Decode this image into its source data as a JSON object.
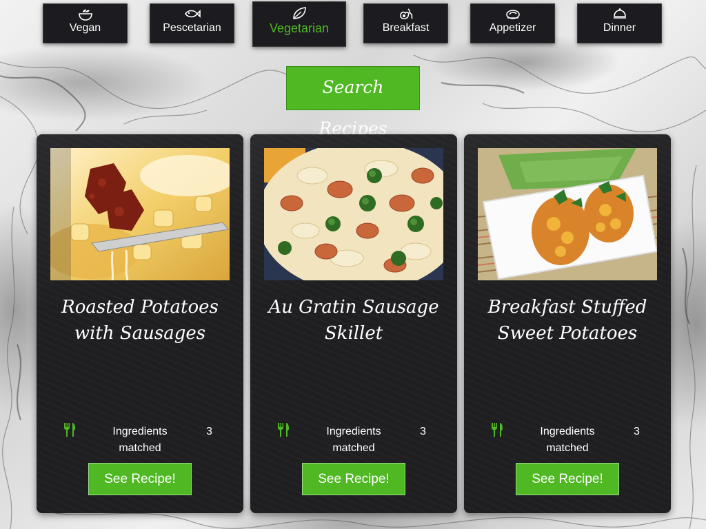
{
  "categories": [
    {
      "label": "Vegan",
      "icon": "bowl-icon",
      "active": false
    },
    {
      "label": "Pescetarian",
      "icon": "fish-icon",
      "active": false
    },
    {
      "label": "Vegetarian",
      "icon": "leaf-icon",
      "active": true
    },
    {
      "label": "Breakfast",
      "icon": "eggs-bacon-icon",
      "active": false
    },
    {
      "label": "Appetizer",
      "icon": "plate-icon",
      "active": false
    },
    {
      "label": "Dinner",
      "icon": "cloche-icon",
      "active": false
    }
  ],
  "search": {
    "label": "Search Recipes"
  },
  "recipes": [
    {
      "title_line1": "Roasted Potatoes",
      "title_line2": "with Sausages",
      "ingredients_label_line1": "Ingredients",
      "ingredients_label_line2": "matched",
      "ingredients_count": "3",
      "button_label": "See Recipe!"
    },
    {
      "title_line1": "Au Gratin Sausage",
      "title_line2": "Skillet",
      "ingredients_label_line1": "Ingredients",
      "ingredients_label_line2": "matched",
      "ingredients_count": "3",
      "button_label": "See Recipe!"
    },
    {
      "title_line1": "Breakfast Stuffed",
      "title_line2": "Sweet Potatoes",
      "ingredients_label_line1": "Ingredients",
      "ingredients_label_line2": "matched",
      "ingredients_count": "3",
      "button_label": "See Recipe!"
    }
  ],
  "colors": {
    "accent_green": "#4fb823",
    "card_background": "#1f1f22",
    "tab_background": "#1c1c20",
    "text_white": "#ffffff"
  }
}
